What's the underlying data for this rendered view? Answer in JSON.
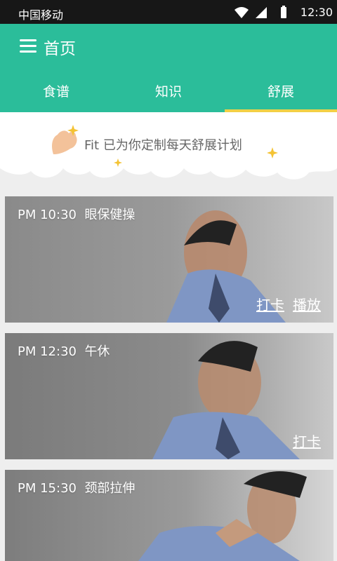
{
  "status_bar": {
    "carrier": "中国移动",
    "time": "12:30"
  },
  "header": {
    "title": "首页"
  },
  "tabs": [
    {
      "label": "食谱",
      "active": false
    },
    {
      "label": "知识",
      "active": false
    },
    {
      "label": "舒展",
      "active": true
    }
  ],
  "banner": {
    "message": "Fit 已为你定制每天舒展计划"
  },
  "cards": [
    {
      "time": "PM 10:30",
      "title": "眼保健操",
      "actions": [
        "打卡",
        "播放"
      ]
    },
    {
      "time": "PM 12:30",
      "title": "午休",
      "actions": [
        "打卡"
      ]
    },
    {
      "time": "PM 15:30",
      "title": "颈部拉伸",
      "actions": []
    }
  ],
  "colors": {
    "primary": "#2bbd9a",
    "tab_indicator": "#f2d046",
    "status_bar": "#171717",
    "accent_star": "#f4c334"
  }
}
